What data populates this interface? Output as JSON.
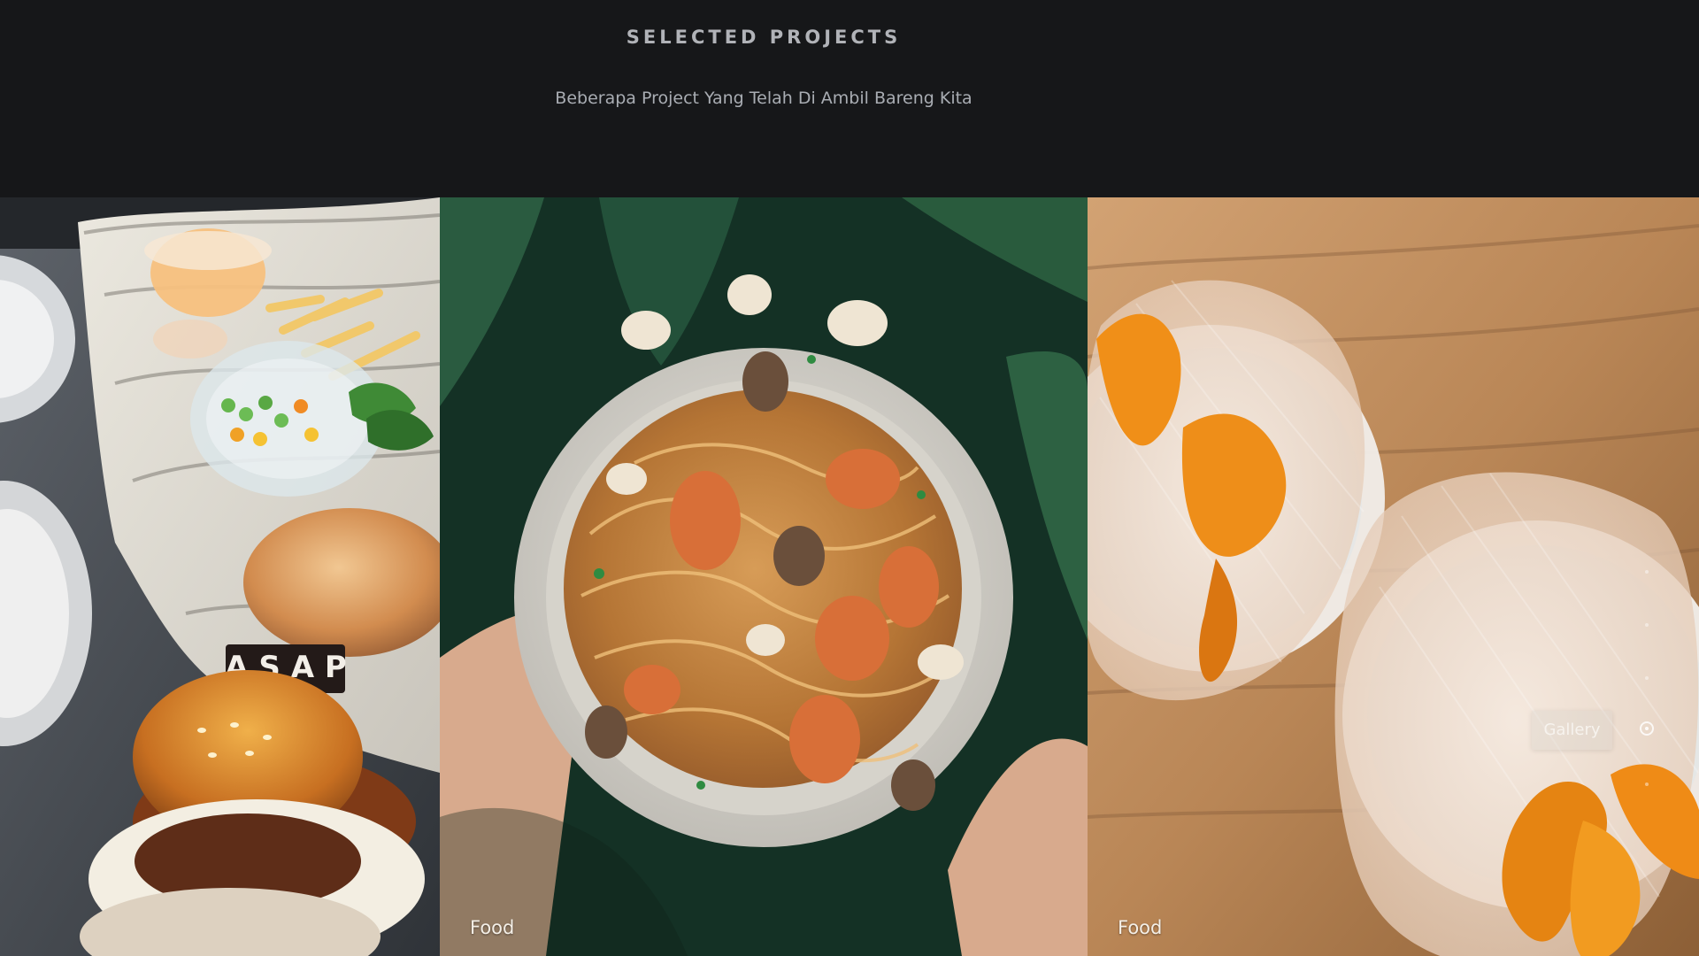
{
  "header": {
    "title": "SELECTED PROJECTS",
    "subtitle": "Beberapa Project Yang Telah Di Ambil Bareng Kita"
  },
  "gallery": {
    "cards": [
      {
        "label": ""
      },
      {
        "label": "Food"
      },
      {
        "label": "Food"
      }
    ],
    "button_label": "Gallery"
  },
  "sidebar": {
    "dots": [
      {
        "active": false
      },
      {
        "active": false
      },
      {
        "active": false
      },
      {
        "active": true
      },
      {
        "active": false
      }
    ]
  },
  "icons": {
    "burger_photo": "burger-photo-icon",
    "noodles_photo": "noodles-photo-icon",
    "gift_bowls_photo": "gift-bowls-photo-icon"
  }
}
